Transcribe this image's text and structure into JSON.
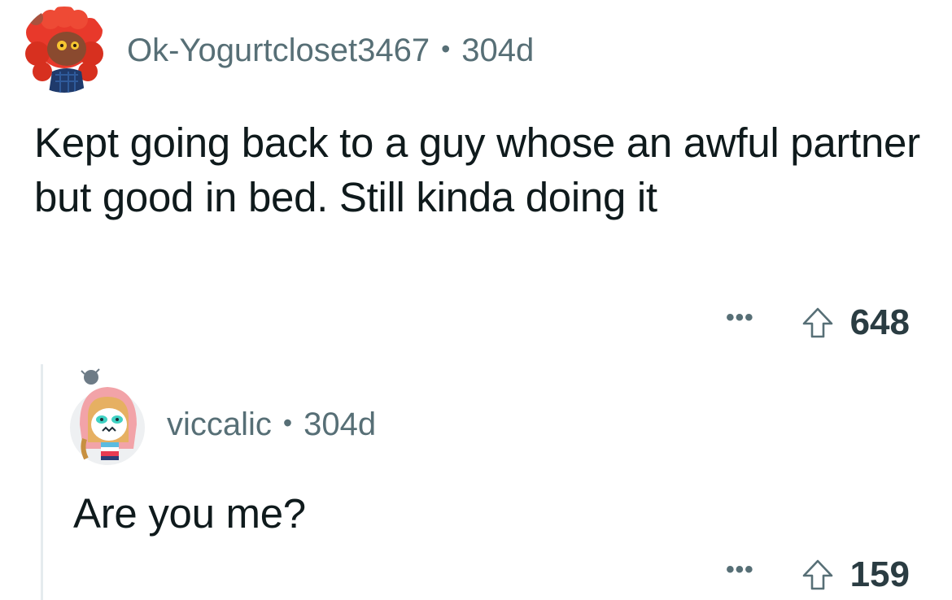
{
  "comments": [
    {
      "username": "Ok-Yogurtcloset3467",
      "separator": "•",
      "age": "304d",
      "body": "Kept going back to a guy whose an awful partner but good in bed. Still kinda doing it",
      "more": "•••",
      "score": "648",
      "upvote_icon": "upvote-arrow-icon",
      "avatar_icon": "red-curly-hair-avatar"
    },
    {
      "username": "viccalic",
      "separator": "•",
      "age": "304d",
      "body": "Are you me?",
      "more": "•••",
      "score": "159",
      "upvote_icon": "upvote-arrow-icon",
      "avatar_icon": "pink-hood-cat-avatar"
    }
  ],
  "colors": {
    "meta": "#576f76",
    "body": "#0f1a1c",
    "thread_line": "#e5ebee",
    "score": "#2a3c42"
  }
}
